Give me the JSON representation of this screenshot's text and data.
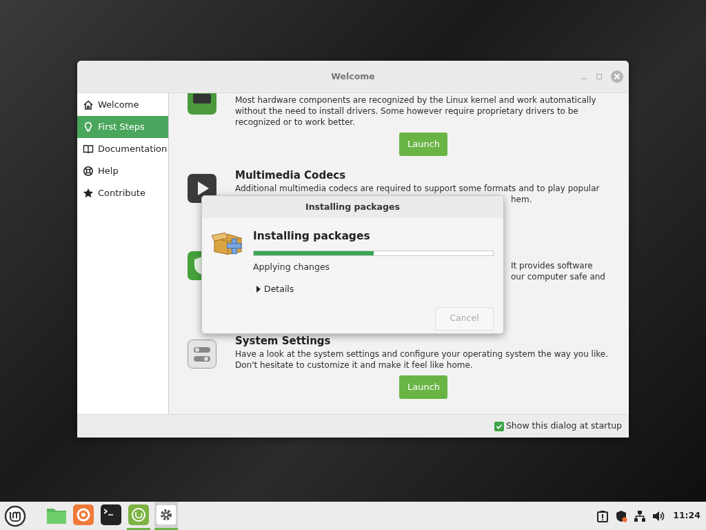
{
  "window": {
    "title": "Welcome"
  },
  "sidebar": {
    "items": [
      {
        "kind": "home",
        "label": "Welcome",
        "selected": false
      },
      {
        "kind": "bulb",
        "label": "First Steps",
        "selected": true
      },
      {
        "kind": "book",
        "label": "Documentation",
        "selected": false
      },
      {
        "kind": "help",
        "label": "Help",
        "selected": false
      },
      {
        "kind": "star",
        "label": "Contribute",
        "selected": false
      }
    ]
  },
  "sections": [
    {
      "kind": "driver",
      "lines": [
        {
          "text": "Most hardware components are recognized by the Linux kernel and work automatically",
          "covered": false
        },
        {
          "text": "without the need to install drivers. Some however require proprietary drivers to be",
          "covered": false
        },
        {
          "text": "recognized or to work better.",
          "covered": false
        }
      ],
      "launch": "Launch"
    },
    {
      "kind": "codecs",
      "title": "Multimedia Codecs",
      "lines": [
        {
          "text": "Additional multimedia codecs are required to support some formats and to play popular",
          "covered": false
        },
        {
          "text": "hem.",
          "covered": true
        }
      ]
    },
    {
      "kind": "firewall",
      "lines": [
        {
          "text": "It provides software",
          "covered": true
        },
        {
          "text": "our computer safe and",
          "covered": true
        }
      ]
    },
    {
      "kind": "settings",
      "title": "System Settings",
      "lines": [
        {
          "text": "Have a look at the system settings and configure your operating system the way you like.",
          "covered": false
        },
        {
          "text": "Don't hesitate to customize it and make it feel like home.",
          "covered": false
        }
      ],
      "launch": "Launch"
    }
  ],
  "footer": {
    "checkbox": {
      "label": "Show this dialog at startup",
      "checked": true
    }
  },
  "dialog": {
    "title": "Installing packages",
    "heading": "Installing packages",
    "progress": {
      "level": 0.5
    },
    "status": "Applying changes",
    "details": {
      "label": "Details",
      "expanded": false
    },
    "cancel": {
      "label": "Cancel",
      "disabled": true
    }
  },
  "taskbar": {
    "apps": [
      {
        "kind": "files",
        "active": false
      },
      {
        "kind": "browser",
        "active": false
      },
      {
        "kind": "terminal",
        "active": false
      },
      {
        "kind": "welcome",
        "active": true
      },
      {
        "kind": "settings",
        "active": true
      }
    ],
    "tray": [
      {
        "kind": "updates"
      },
      {
        "kind": "shield"
      },
      {
        "kind": "network"
      },
      {
        "kind": "volume"
      }
    ],
    "clock": "11:24"
  }
}
